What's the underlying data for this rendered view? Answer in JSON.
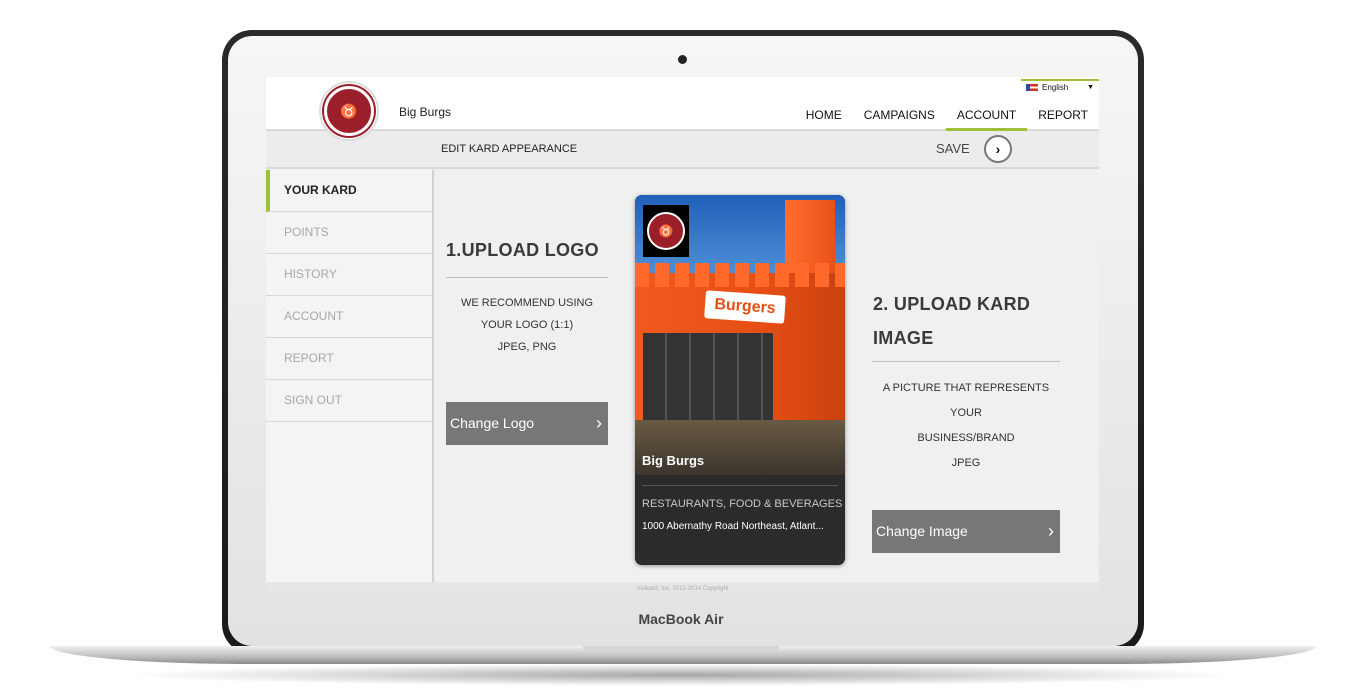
{
  "device": {
    "brand": "MacBook Air"
  },
  "header": {
    "business_name": "Big Burgs",
    "language": "English",
    "nav": [
      {
        "label": "HOME"
      },
      {
        "label": "CAMPAIGNS"
      },
      {
        "label": "ACCOUNT",
        "active": true
      },
      {
        "label": "REPORT"
      }
    ]
  },
  "toolbar": {
    "title": "EDIT KARD APPEARANCE",
    "save_label": "SAVE"
  },
  "sidebar": {
    "items": [
      {
        "label": "YOUR KARD",
        "active": true
      },
      {
        "label": "POINTS"
      },
      {
        "label": "HISTORY"
      },
      {
        "label": "ACCOUNT"
      },
      {
        "label": "REPORT"
      },
      {
        "label": "SIGN OUT"
      }
    ]
  },
  "upload_logo": {
    "heading": "1.UPLOAD LOGO",
    "lines": [
      "WE RECOMMEND USING",
      "YOUR LOGO (1:1)",
      "JPEG, PNG"
    ],
    "button": "Change Logo"
  },
  "upload_image": {
    "heading_line1": "2. UPLOAD KARD",
    "heading_line2": "IMAGE",
    "lines": [
      "A PICTURE THAT REPRESENTS",
      "YOUR",
      "BUSINESS/BRAND",
      "JPEG"
    ],
    "button": "Change Image"
  },
  "card": {
    "name": "Big Burgs",
    "category": "RESTAURANTS, FOOD & BEVERAGES",
    "address": "1000 Abernathy Road Northeast, Atlant...",
    "sign_text": "Burgers"
  },
  "footer": {
    "copyright": "Vivikard, Inc. 2013-2014 Copyright"
  },
  "colors": {
    "accent": "#9dc23a",
    "brand_red": "#9b1f2a",
    "button_gray": "#777777"
  }
}
